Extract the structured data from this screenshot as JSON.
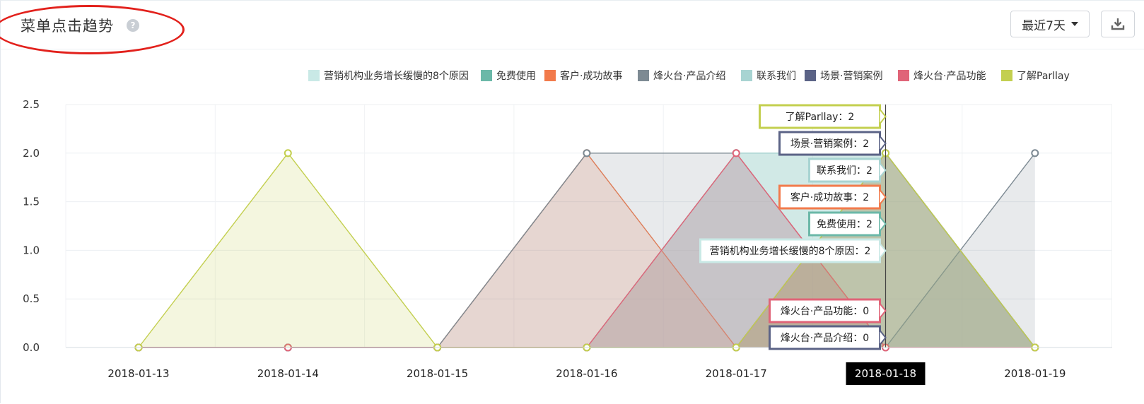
{
  "header": {
    "title": "菜单点击趋势",
    "help_icon": "question-circle-icon",
    "range_label": "最近7天",
    "range_icon": "caret-down-icon",
    "download_icon": "download-icon"
  },
  "chart_data": {
    "type": "area",
    "categories": [
      "2018-01-13",
      "2018-01-14",
      "2018-01-15",
      "2018-01-16",
      "2018-01-17",
      "2018-01-18",
      "2018-01-19"
    ],
    "y_ticks": [
      "0.0",
      "0.5",
      "1.0",
      "1.5",
      "2.0",
      "2.5"
    ],
    "ylim": [
      0,
      2.5
    ],
    "grid": true,
    "legend_position": "top-right",
    "series": [
      {
        "name": "营销机构业务增长缓慢的8个原因",
        "color": "#c9e9e6",
        "values": [
          0,
          0,
          0,
          0,
          2,
          2,
          0
        ]
      },
      {
        "name": "免费使用",
        "color": "#6bb8a8",
        "values": [
          0,
          0,
          0,
          0,
          2,
          2,
          0
        ]
      },
      {
        "name": "客户·成功故事",
        "color": "#f27a4b",
        "values": [
          0,
          0,
          0,
          2,
          0,
          2,
          0
        ]
      },
      {
        "name": "烽火台·产品介绍",
        "color": "#7d8a93",
        "values": [
          0,
          0,
          0,
          2,
          2,
          0,
          2
        ]
      },
      {
        "name": "联系我们",
        "color": "#a8d4d2",
        "values": [
          0,
          0,
          0,
          0,
          2,
          2,
          0
        ]
      },
      {
        "name": "场景·营销案例",
        "color": "#5b6386",
        "values": [
          0,
          0,
          0,
          0,
          0,
          2,
          0
        ]
      },
      {
        "name": "烽火台·产品功能",
        "color": "#e06478",
        "values": [
          0,
          0,
          0,
          0,
          2,
          0,
          0
        ]
      },
      {
        "name": "了解Parllay",
        "color": "#c3cf4f",
        "values": [
          0,
          2,
          0,
          0,
          0,
          2,
          0
        ]
      }
    ],
    "tooltip": {
      "category": "2018-01-18",
      "items": [
        {
          "label": "了解Parllay：2",
          "color": "#c3cf4f"
        },
        {
          "label": "场景·营销案例：2",
          "color": "#5b6386"
        },
        {
          "label": "联系我们：2",
          "color": "#a8d4d2"
        },
        {
          "label": "客户·成功故事：2",
          "color": "#f27a4b"
        },
        {
          "label": "免费使用：2",
          "color": "#6bb8a8"
        },
        {
          "label": "营销机构业务增长缓慢的8个原因：2",
          "color": "#c9e9e6"
        },
        {
          "label": "烽火台·产品功能：0",
          "color": "#e06478"
        },
        {
          "label": "烽火台·产品介绍：0",
          "color": "#5b6386"
        }
      ]
    }
  }
}
